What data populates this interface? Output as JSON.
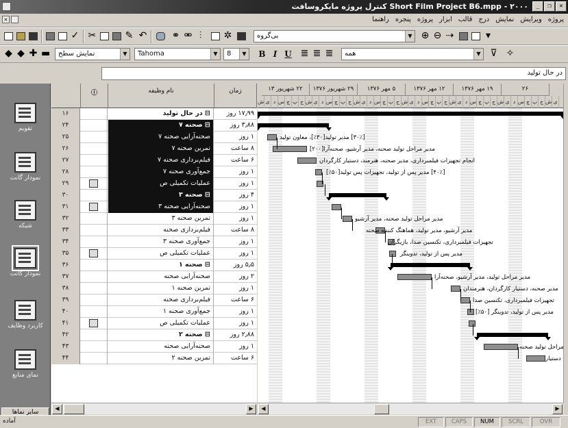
{
  "window": {
    "title": "Short Film Project B6.mpp - ۲۰۰۰ کنترل پروژه مایکروسافت",
    "buttons": [
      "_",
      "❐",
      "✕"
    ]
  },
  "menu": {
    "items": [
      "پروژه",
      "ویرایش",
      "نمایش",
      "درج",
      "قالب",
      "ابزار",
      "پروژه",
      "پنجره",
      "راهنما"
    ]
  },
  "toolbar": {
    "group_combo": "بی‌گروه",
    "outline_combo": "نمایش سطح",
    "font_combo": "Tahoma",
    "size_combo": "8",
    "filter_combo": "همه",
    "bold": "B",
    "italic": "I",
    "underline": "U"
  },
  "entry": {
    "value": "در حال تولید"
  },
  "views": [
    {
      "label": "تقویم"
    },
    {
      "label": "نمودار گانت"
    },
    {
      "label": "شبکه"
    },
    {
      "label": "نمودار گانت"
    },
    {
      "label": "کاربرد وظایف"
    },
    {
      "label": "نمای منابع"
    }
  ],
  "view_more": "سایر نماها",
  "sheet": {
    "headers": {
      "info": "ⓘ",
      "name": "نام وظیفه",
      "duration": "زمان"
    },
    "rows": [
      {
        "id": "۱۶",
        "name": "⊟ در حال تولید",
        "dur": "۱۷٫۹۹ روز",
        "selected": false,
        "summary": true,
        "icon": false
      },
      {
        "id": "۲۴",
        "name": "⊟ صحنه ۷",
        "dur": "۳٫۸۸ روز",
        "selected": true,
        "summary": true,
        "icon": false
      },
      {
        "id": "۲۵",
        "name": "صحنه‌آرایی صحنه ۷",
        "dur": "۱ روز",
        "selected": true,
        "summary": false,
        "icon": false
      },
      {
        "id": "۲۶",
        "name": "تمرین صحنه ۷",
        "dur": "۸ ساعت",
        "selected": true,
        "summary": false,
        "icon": false
      },
      {
        "id": "۲۷",
        "name": "فیلم‌برداری صحنه ۷",
        "dur": "۶ ساعت",
        "selected": true,
        "summary": false,
        "icon": false
      },
      {
        "id": "۲۸",
        "name": "جمع‌آوری صحنه ۷",
        "dur": "۱ روز",
        "selected": true,
        "summary": false,
        "icon": false
      },
      {
        "id": "۲۹",
        "name": "عملیات تکمیلی ص",
        "dur": "۱ روز",
        "selected": true,
        "summary": false,
        "icon": true
      },
      {
        "id": "۳۰",
        "name": "⊟ صحنه ۳",
        "dur": "۴ روز",
        "selected": true,
        "summary": true,
        "icon": false
      },
      {
        "id": "۳۱",
        "name": "صحنه‌آرایی صحنه ۳",
        "dur": "۱ روز",
        "selected": true,
        "summary": false,
        "icon": true
      },
      {
        "id": "۳۲",
        "name": "تمرین صحنه ۳",
        "dur": "۱ روز",
        "selected": false,
        "summary": false,
        "icon": false
      },
      {
        "id": "۳۳",
        "name": "فیلم‌برداری صحنه",
        "dur": "۸ ساعت",
        "selected": false,
        "summary": false,
        "icon": false
      },
      {
        "id": "۳۴",
        "name": "جمع‌آوری صحنه ۳",
        "dur": "۱ روز",
        "selected": false,
        "summary": false,
        "icon": false
      },
      {
        "id": "۳۵",
        "name": "عملیات تکمیلی ص",
        "dur": "۱ روز",
        "selected": false,
        "summary": false,
        "icon": true
      },
      {
        "id": "۳۶",
        "name": "⊟ صحنه ۱",
        "dur": "۵٫۵ روز",
        "selected": false,
        "summary": true,
        "icon": false
      },
      {
        "id": "۳۷",
        "name": "صحنه‌آرایی صحنه",
        "dur": "۲ روز",
        "selected": false,
        "summary": false,
        "icon": false
      },
      {
        "id": "۳۸",
        "name": "تمرین صحنه ۱",
        "dur": "۱ روز",
        "selected": false,
        "summary": false,
        "icon": false
      },
      {
        "id": "۳۹",
        "name": "فیلم‌برداری صحنه",
        "dur": "۶ ساعت",
        "selected": false,
        "summary": false,
        "icon": false
      },
      {
        "id": "۴۰",
        "name": "جمع‌آوری صحنه ۱",
        "dur": "۱ روز",
        "selected": false,
        "summary": false,
        "icon": false
      },
      {
        "id": "۴۱",
        "name": "عملیات تکمیلی ص",
        "dur": "۱ روز",
        "selected": false,
        "summary": false,
        "icon": true
      },
      {
        "id": "۴۲",
        "name": "⊟ صحنه ۲",
        "dur": "۲٫۸۸ روز",
        "selected": false,
        "summary": true,
        "icon": false
      },
      {
        "id": "۴۳",
        "name": "صحنه‌آرایی صحنه",
        "dur": "۱ روز",
        "selected": false,
        "summary": false,
        "icon": false
      },
      {
        "id": "۴۴",
        "name": "تمرین صحنه ۲",
        "dur": "۶ ساعت",
        "selected": false,
        "summary": false,
        "icon": false
      }
    ]
  },
  "gantt": {
    "weeks": [
      "۲۲ شهریور ۱۳",
      "۲۹ شهریور ۱۳۷۶",
      "۵ مهر ۱۳۷۶",
      "۱۲ مهر ۱۳۷۶",
      "۱۹ مهر ۱۳۷۶",
      "۲۶"
    ],
    "day_letters": [
      "ش",
      "ی",
      "د",
      "س",
      "چ",
      "پ",
      "ج"
    ],
    "labels": [
      "[۳۰٪] مدیر تولید[۳۰٪]، معاون تولید",
      "مدیر مراحل تولید صحنه، مدیر آرشیو، صحنه‌آرا[۲۰۰]",
      "انجام تجهیزات فیلمبرداری، مدیر صحنه، هنرمند، دستیار کارگردان",
      "[۴۰٪] مدیر پس از تولید، تجهیزات پس تولید[۵۰٪]",
      "مدیر مراحل تولید صحنه، مدیر آرشیو",
      "مدیر آرشیو، مدیر تولید، هماهنگ کننده صحنه",
      "تجهیزات فیلمبرداری، تکنسین صدا، بازیگران",
      "مدیر پس از تولید، تدوینگر",
      "مدیر مراحل تولید، مدیر آرشیو، صحنه‌آرا",
      "مدیر صحنه، دستیار کارگردان، هنرمندان",
      "تجهیزات فیلمبرداری، تکنسین صدا",
      "مدیر پس از تولید، تدوینگر [۵۰٪]",
      "مدیر مراحل تولید صحنه",
      "مدیر صحنه، دستیار"
    ]
  },
  "status": {
    "ready": "آماده",
    "indicators": [
      "EXT",
      "CAPS",
      "NUM",
      "SCRL",
      "OVR"
    ]
  }
}
